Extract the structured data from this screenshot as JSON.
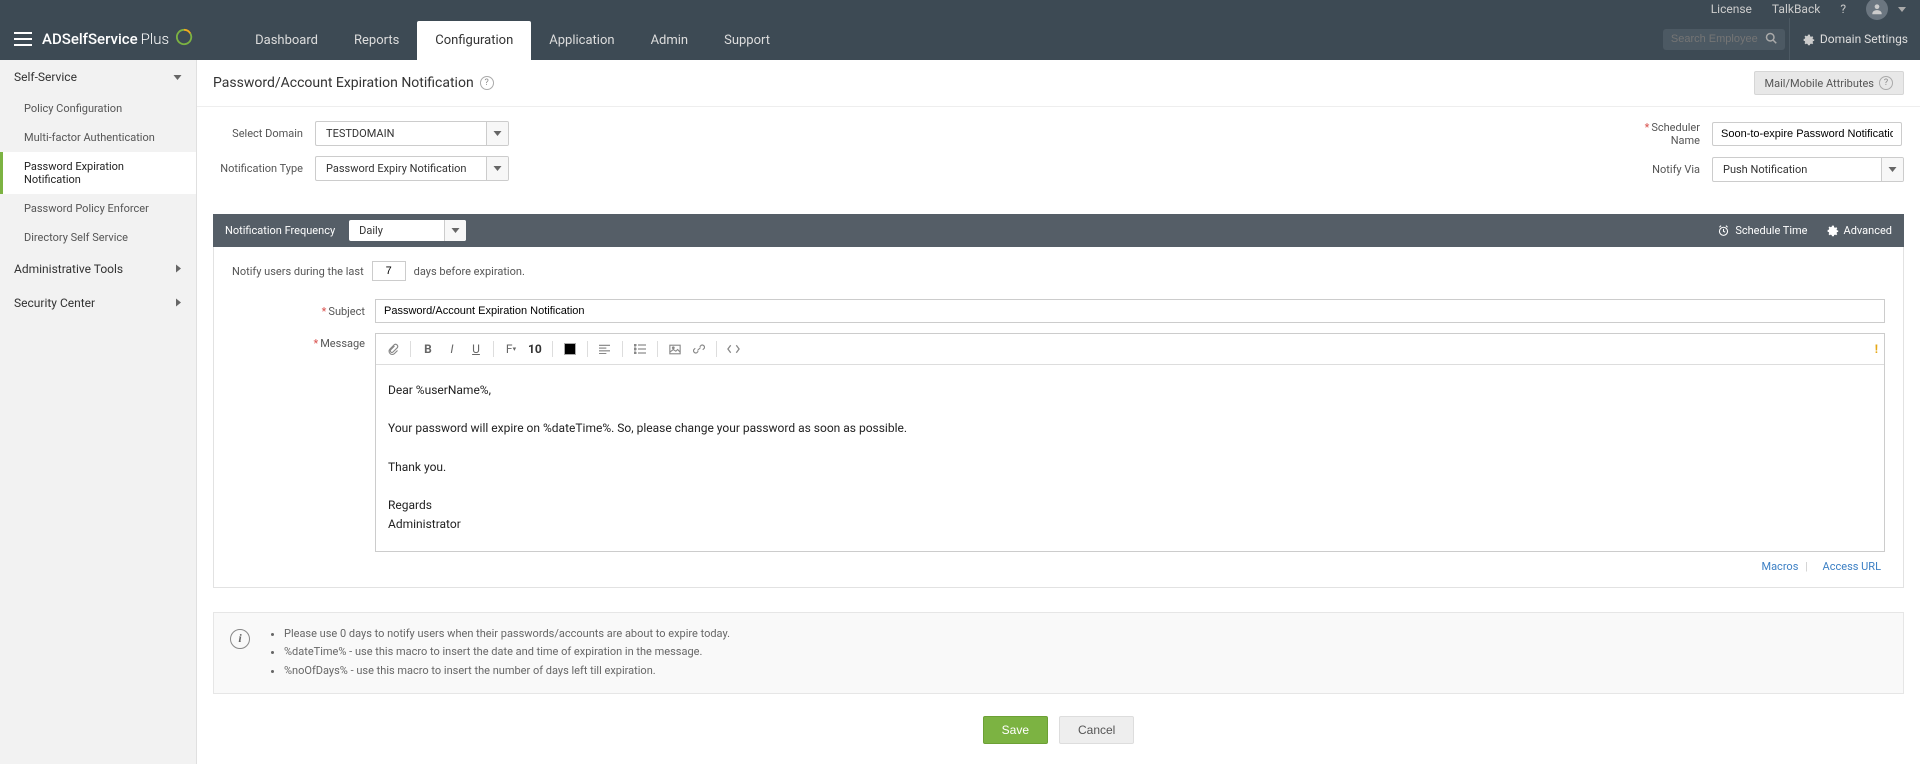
{
  "top": {
    "brand": "ADSelfService",
    "brand_suffix": "Plus",
    "links": {
      "license": "License",
      "talkback": "TalkBack"
    },
    "search_placeholder": "Search Employee",
    "domain_settings": "Domain Settings",
    "tabs": [
      "Dashboard",
      "Reports",
      "Configuration",
      "Application",
      "Admin",
      "Support"
    ],
    "active_tab": "Configuration"
  },
  "sidebar": {
    "sections": [
      {
        "label": "Self-Service",
        "expanded": true,
        "items": [
          "Policy Configuration",
          "Multi-factor Authentication",
          "Password Expiration Notification",
          "Password Policy Enforcer",
          "Directory Self Service"
        ],
        "active": "Password Expiration Notification"
      },
      {
        "label": "Administrative Tools",
        "expanded": false,
        "items": []
      },
      {
        "label": "Security Center",
        "expanded": false,
        "items": []
      }
    ]
  },
  "page": {
    "title": "Password/Account Expiration Notification",
    "mail_attrs": "Mail/Mobile Attributes"
  },
  "form": {
    "select_domain_label": "Select Domain",
    "select_domain_value": "TESTDOMAIN",
    "notification_type_label": "Notification Type",
    "notification_type_value": "Password Expiry Notification",
    "scheduler_name_label": "Scheduler Name",
    "scheduler_name_value": "Soon-to-expire Password Notification Scheduler",
    "notify_via_label": "Notify Via",
    "notify_via_value": "Push Notification"
  },
  "freq": {
    "label": "Notification Frequency",
    "value": "Daily",
    "schedule_time": "Schedule Time",
    "advanced": "Advanced"
  },
  "notify": {
    "line_prefix": "Notify users during the last",
    "days_value": "7",
    "line_suffix": "days before expiration.",
    "subject_label": "Subject",
    "subject_value": "Password/Account Expiration Notification",
    "message_label": "Message",
    "font_size": "10",
    "message_body": "Dear %userName%,\n\nYour password will expire on %dateTime%. So, please change your password as soon as possible.\n\nThank you.\n\nRegards\nAdministrator",
    "macros_link": "Macros",
    "access_url_link": "Access URL"
  },
  "info": {
    "tips": [
      "Please use 0 days to notify users when their passwords/accounts are about to expire today.",
      "%dateTime% - use this macro to insert the date and time of expiration in the message.",
      "%noOfDays% - use this macro to insert the number of days left till expiration."
    ]
  },
  "buttons": {
    "save": "Save",
    "cancel": "Cancel"
  }
}
